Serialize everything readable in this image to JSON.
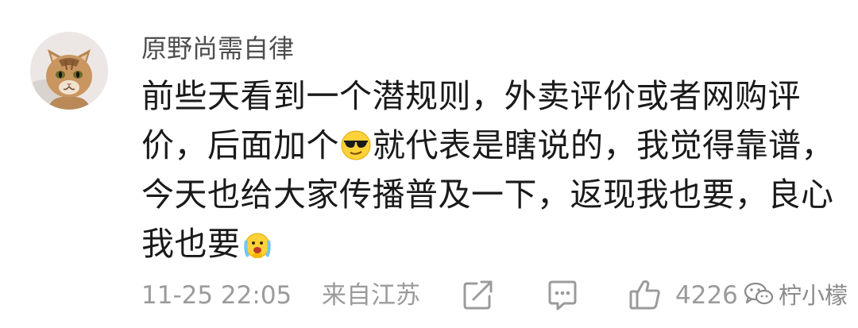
{
  "comment": {
    "username": "原野尚需自律",
    "text_lines": [
      "前些天看到一个潜规则，外卖评价或者网购评",
      "价，后面加个",
      "就代表是瞎说的，我觉得靠谱，",
      "今天也给大家传播普及一下，返现我也要，良心",
      "我也要"
    ],
    "emojis": [
      "sunglasses-emoji",
      "crying-emoji"
    ],
    "timestamp": "11-25 22:05",
    "location": "来自江苏",
    "like_count": "4226"
  },
  "watermark": {
    "text": "柠小檬"
  },
  "icons": {
    "share": "share-icon",
    "reply": "comment-icon",
    "like": "thumbs-up-icon",
    "watermark": "wechat-icon"
  },
  "colors": {
    "text_primary": "#1a1a1a",
    "text_username": "#4e4e4e",
    "text_meta": "#9b9b9b",
    "background": "#ffffff"
  }
}
